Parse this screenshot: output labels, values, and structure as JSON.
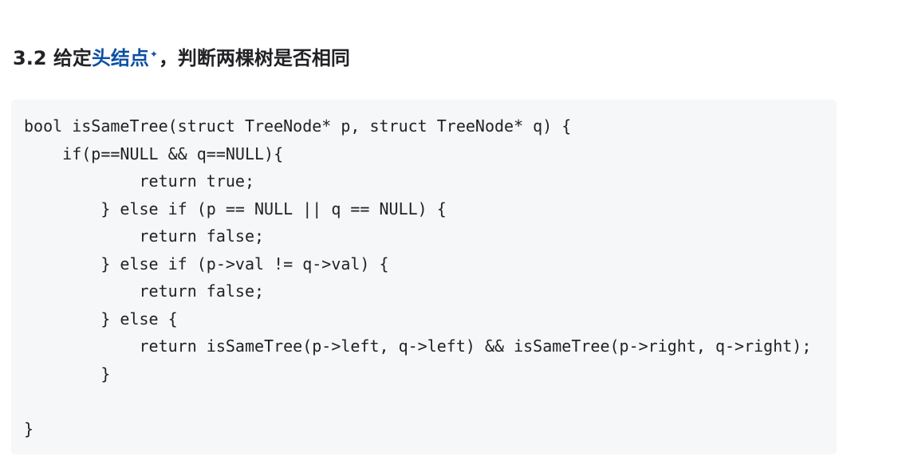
{
  "heading": {
    "number": "3.2 ",
    "prefix": "给定",
    "link_text": "头结点",
    "sparkle": "✦",
    "suffix": "，判断两棵树是否相同",
    "link_color": "#0b4fa5"
  },
  "code": {
    "language": "c",
    "lines": [
      "bool isSameTree(struct TreeNode* p, struct TreeNode* q) {",
      "    if(p==NULL && q==NULL){",
      "            return true;",
      "        } else if (p == NULL || q == NULL) {",
      "            return false;",
      "        } else if (p->val != q->val) {",
      "            return false;",
      "        } else {",
      "            return isSameTree(p->left, q->left) && isSameTree(p->right, q->right);",
      "        }",
      "",
      "}"
    ]
  }
}
